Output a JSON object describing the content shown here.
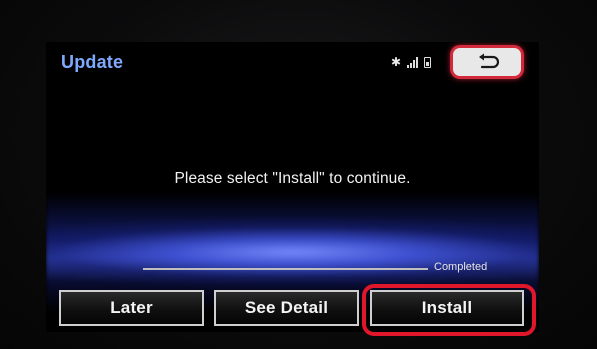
{
  "header": {
    "title": "Update",
    "status_icons": [
      "bluetooth-icon",
      "signal-icon",
      "battery-icon"
    ],
    "back_icon": "return-arrow-icon"
  },
  "message": "Please select \"Install\" to continue.",
  "progress": {
    "label": "Completed"
  },
  "buttons": {
    "later": "Later",
    "see_detail": "See Detail",
    "install": "Install"
  },
  "colors": {
    "title": "#7fa9ff",
    "highlight": "#e0172b",
    "glow": "#4a5ee0"
  }
}
